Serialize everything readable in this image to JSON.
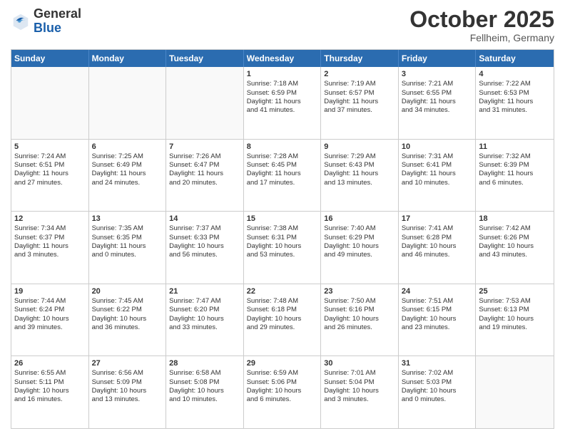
{
  "header": {
    "logo": {
      "general": "General",
      "blue": "Blue"
    },
    "title": "October 2025",
    "location": "Fellheim, Germany"
  },
  "weekdays": [
    "Sunday",
    "Monday",
    "Tuesday",
    "Wednesday",
    "Thursday",
    "Friday",
    "Saturday"
  ],
  "rows": [
    [
      {
        "day": "",
        "info": []
      },
      {
        "day": "",
        "info": []
      },
      {
        "day": "",
        "info": []
      },
      {
        "day": "1",
        "info": [
          "Sunrise: 7:18 AM",
          "Sunset: 6:59 PM",
          "Daylight: 11 hours",
          "and 41 minutes."
        ]
      },
      {
        "day": "2",
        "info": [
          "Sunrise: 7:19 AM",
          "Sunset: 6:57 PM",
          "Daylight: 11 hours",
          "and 37 minutes."
        ]
      },
      {
        "day": "3",
        "info": [
          "Sunrise: 7:21 AM",
          "Sunset: 6:55 PM",
          "Daylight: 11 hours",
          "and 34 minutes."
        ]
      },
      {
        "day": "4",
        "info": [
          "Sunrise: 7:22 AM",
          "Sunset: 6:53 PM",
          "Daylight: 11 hours",
          "and 31 minutes."
        ]
      }
    ],
    [
      {
        "day": "5",
        "info": [
          "Sunrise: 7:24 AM",
          "Sunset: 6:51 PM",
          "Daylight: 11 hours",
          "and 27 minutes."
        ]
      },
      {
        "day": "6",
        "info": [
          "Sunrise: 7:25 AM",
          "Sunset: 6:49 PM",
          "Daylight: 11 hours",
          "and 24 minutes."
        ]
      },
      {
        "day": "7",
        "info": [
          "Sunrise: 7:26 AM",
          "Sunset: 6:47 PM",
          "Daylight: 11 hours",
          "and 20 minutes."
        ]
      },
      {
        "day": "8",
        "info": [
          "Sunrise: 7:28 AM",
          "Sunset: 6:45 PM",
          "Daylight: 11 hours",
          "and 17 minutes."
        ]
      },
      {
        "day": "9",
        "info": [
          "Sunrise: 7:29 AM",
          "Sunset: 6:43 PM",
          "Daylight: 11 hours",
          "and 13 minutes."
        ]
      },
      {
        "day": "10",
        "info": [
          "Sunrise: 7:31 AM",
          "Sunset: 6:41 PM",
          "Daylight: 11 hours",
          "and 10 minutes."
        ]
      },
      {
        "day": "11",
        "info": [
          "Sunrise: 7:32 AM",
          "Sunset: 6:39 PM",
          "Daylight: 11 hours",
          "and 6 minutes."
        ]
      }
    ],
    [
      {
        "day": "12",
        "info": [
          "Sunrise: 7:34 AM",
          "Sunset: 6:37 PM",
          "Daylight: 11 hours",
          "and 3 minutes."
        ]
      },
      {
        "day": "13",
        "info": [
          "Sunrise: 7:35 AM",
          "Sunset: 6:35 PM",
          "Daylight: 11 hours",
          "and 0 minutes."
        ]
      },
      {
        "day": "14",
        "info": [
          "Sunrise: 7:37 AM",
          "Sunset: 6:33 PM",
          "Daylight: 10 hours",
          "and 56 minutes."
        ]
      },
      {
        "day": "15",
        "info": [
          "Sunrise: 7:38 AM",
          "Sunset: 6:31 PM",
          "Daylight: 10 hours",
          "and 53 minutes."
        ]
      },
      {
        "day": "16",
        "info": [
          "Sunrise: 7:40 AM",
          "Sunset: 6:29 PM",
          "Daylight: 10 hours",
          "and 49 minutes."
        ]
      },
      {
        "day": "17",
        "info": [
          "Sunrise: 7:41 AM",
          "Sunset: 6:28 PM",
          "Daylight: 10 hours",
          "and 46 minutes."
        ]
      },
      {
        "day": "18",
        "info": [
          "Sunrise: 7:42 AM",
          "Sunset: 6:26 PM",
          "Daylight: 10 hours",
          "and 43 minutes."
        ]
      }
    ],
    [
      {
        "day": "19",
        "info": [
          "Sunrise: 7:44 AM",
          "Sunset: 6:24 PM",
          "Daylight: 10 hours",
          "and 39 minutes."
        ]
      },
      {
        "day": "20",
        "info": [
          "Sunrise: 7:45 AM",
          "Sunset: 6:22 PM",
          "Daylight: 10 hours",
          "and 36 minutes."
        ]
      },
      {
        "day": "21",
        "info": [
          "Sunrise: 7:47 AM",
          "Sunset: 6:20 PM",
          "Daylight: 10 hours",
          "and 33 minutes."
        ]
      },
      {
        "day": "22",
        "info": [
          "Sunrise: 7:48 AM",
          "Sunset: 6:18 PM",
          "Daylight: 10 hours",
          "and 29 minutes."
        ]
      },
      {
        "day": "23",
        "info": [
          "Sunrise: 7:50 AM",
          "Sunset: 6:16 PM",
          "Daylight: 10 hours",
          "and 26 minutes."
        ]
      },
      {
        "day": "24",
        "info": [
          "Sunrise: 7:51 AM",
          "Sunset: 6:15 PM",
          "Daylight: 10 hours",
          "and 23 minutes."
        ]
      },
      {
        "day": "25",
        "info": [
          "Sunrise: 7:53 AM",
          "Sunset: 6:13 PM",
          "Daylight: 10 hours",
          "and 19 minutes."
        ]
      }
    ],
    [
      {
        "day": "26",
        "info": [
          "Sunrise: 6:55 AM",
          "Sunset: 5:11 PM",
          "Daylight: 10 hours",
          "and 16 minutes."
        ]
      },
      {
        "day": "27",
        "info": [
          "Sunrise: 6:56 AM",
          "Sunset: 5:09 PM",
          "Daylight: 10 hours",
          "and 13 minutes."
        ]
      },
      {
        "day": "28",
        "info": [
          "Sunrise: 6:58 AM",
          "Sunset: 5:08 PM",
          "Daylight: 10 hours",
          "and 10 minutes."
        ]
      },
      {
        "day": "29",
        "info": [
          "Sunrise: 6:59 AM",
          "Sunset: 5:06 PM",
          "Daylight: 10 hours",
          "and 6 minutes."
        ]
      },
      {
        "day": "30",
        "info": [
          "Sunrise: 7:01 AM",
          "Sunset: 5:04 PM",
          "Daylight: 10 hours",
          "and 3 minutes."
        ]
      },
      {
        "day": "31",
        "info": [
          "Sunrise: 7:02 AM",
          "Sunset: 5:03 PM",
          "Daylight: 10 hours",
          "and 0 minutes."
        ]
      },
      {
        "day": "",
        "info": []
      }
    ]
  ]
}
